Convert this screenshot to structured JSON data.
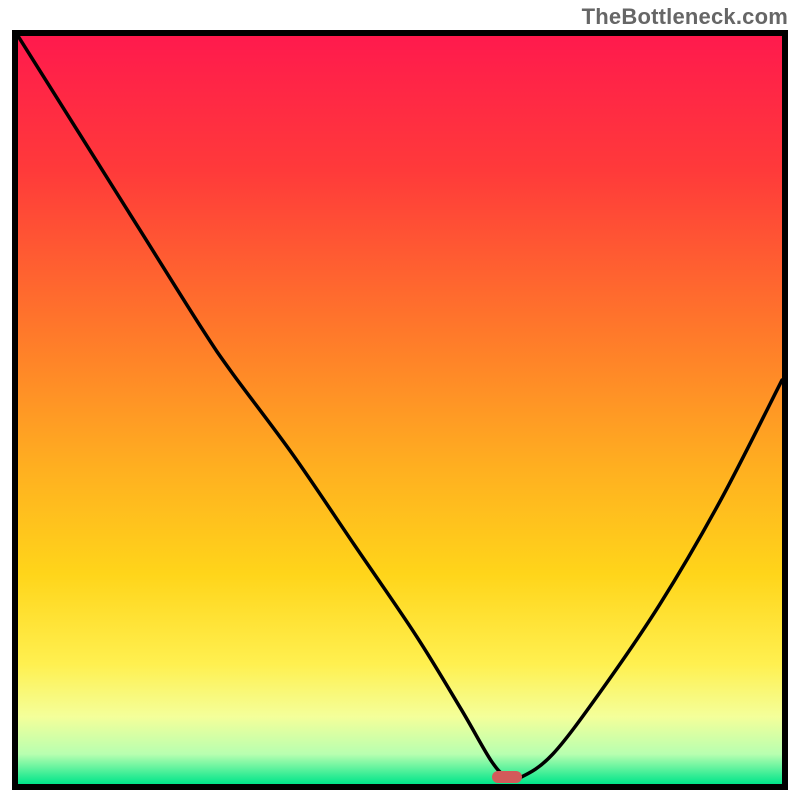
{
  "watermark": "TheBottleneck.com",
  "colors": {
    "gradient": {
      "0": "#ff1a4d",
      "18": "#ff3a3a",
      "40": "#ff7a2a",
      "58": "#ffb020",
      "72": "#ffd51a",
      "84": "#fff050",
      "91": "#f4ff9a",
      "96": "#b8ffb0",
      "100": "#00e58a"
    },
    "curve_stroke": "#000000",
    "marker_fill": "#d35a5a"
  },
  "chart_data": {
    "type": "line",
    "title": "",
    "xlabel": "",
    "ylabel": "",
    "xlim": [
      0,
      100
    ],
    "ylim": [
      0,
      100
    ],
    "y_axis_note": "y = bottleneck level; high at top (red), zero at bottom (green)",
    "series": [
      {
        "name": "bottleneck-curve",
        "x": [
          0,
          8,
          16,
          24,
          28,
          36,
          44,
          52,
          58,
          62,
          64,
          66,
          70,
          76,
          84,
          92,
          100
        ],
        "y": [
          100,
          87,
          74,
          61,
          55,
          44,
          32,
          20,
          10,
          3,
          1,
          1,
          4,
          12,
          24,
          38,
          54
        ]
      }
    ],
    "optimal_marker": {
      "x": 64,
      "y": 1,
      "width_pct": 4
    }
  }
}
